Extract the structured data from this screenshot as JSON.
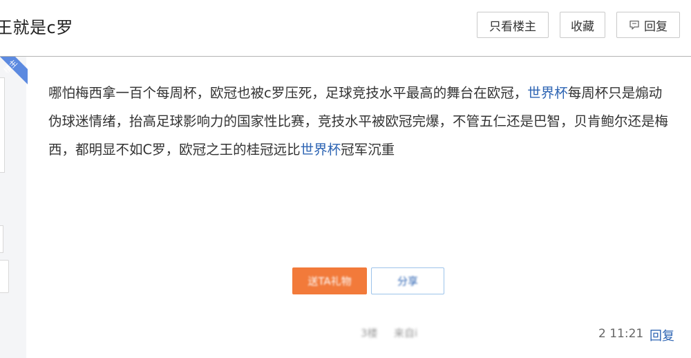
{
  "header": {
    "thread_title": "王就是c罗",
    "only_op_label": "只看楼主",
    "collect_label": "收藏",
    "reply_label": "回复"
  },
  "badge": {
    "label": "楼主",
    "color": "#5c8ae0"
  },
  "post": {
    "segments": [
      {
        "text": "哪怕梅西拿一百个每周杯，欧冠也被c罗压死，足球竞技水平最高的舞台在欧冠，",
        "link": false
      },
      {
        "text": "世界杯",
        "link": true
      },
      {
        "text": "每周杯只是煽动伪球迷情绪，抬高足球影响力的国家性比赛，竞技水平被欧冠完爆，不管五仁还是巴智，贝肯鲍尔还是梅西，都明显不如C罗，欧冠之王的桂冠远比",
        "link": false
      },
      {
        "text": "世界杯",
        "link": true
      },
      {
        "text": "冠军沉重",
        "link": false
      }
    ]
  },
  "actions": {
    "gift_label": "送TA礼物",
    "share_label": "分享"
  },
  "footer": {
    "blurred_left": "3楼",
    "blurred_source": "来自i",
    "time": "2 11:21",
    "reply_label": "回复"
  },
  "colors": {
    "link": "#2d64b3",
    "gift_button": "#f27a3a",
    "divider": "#b3b3b3"
  }
}
